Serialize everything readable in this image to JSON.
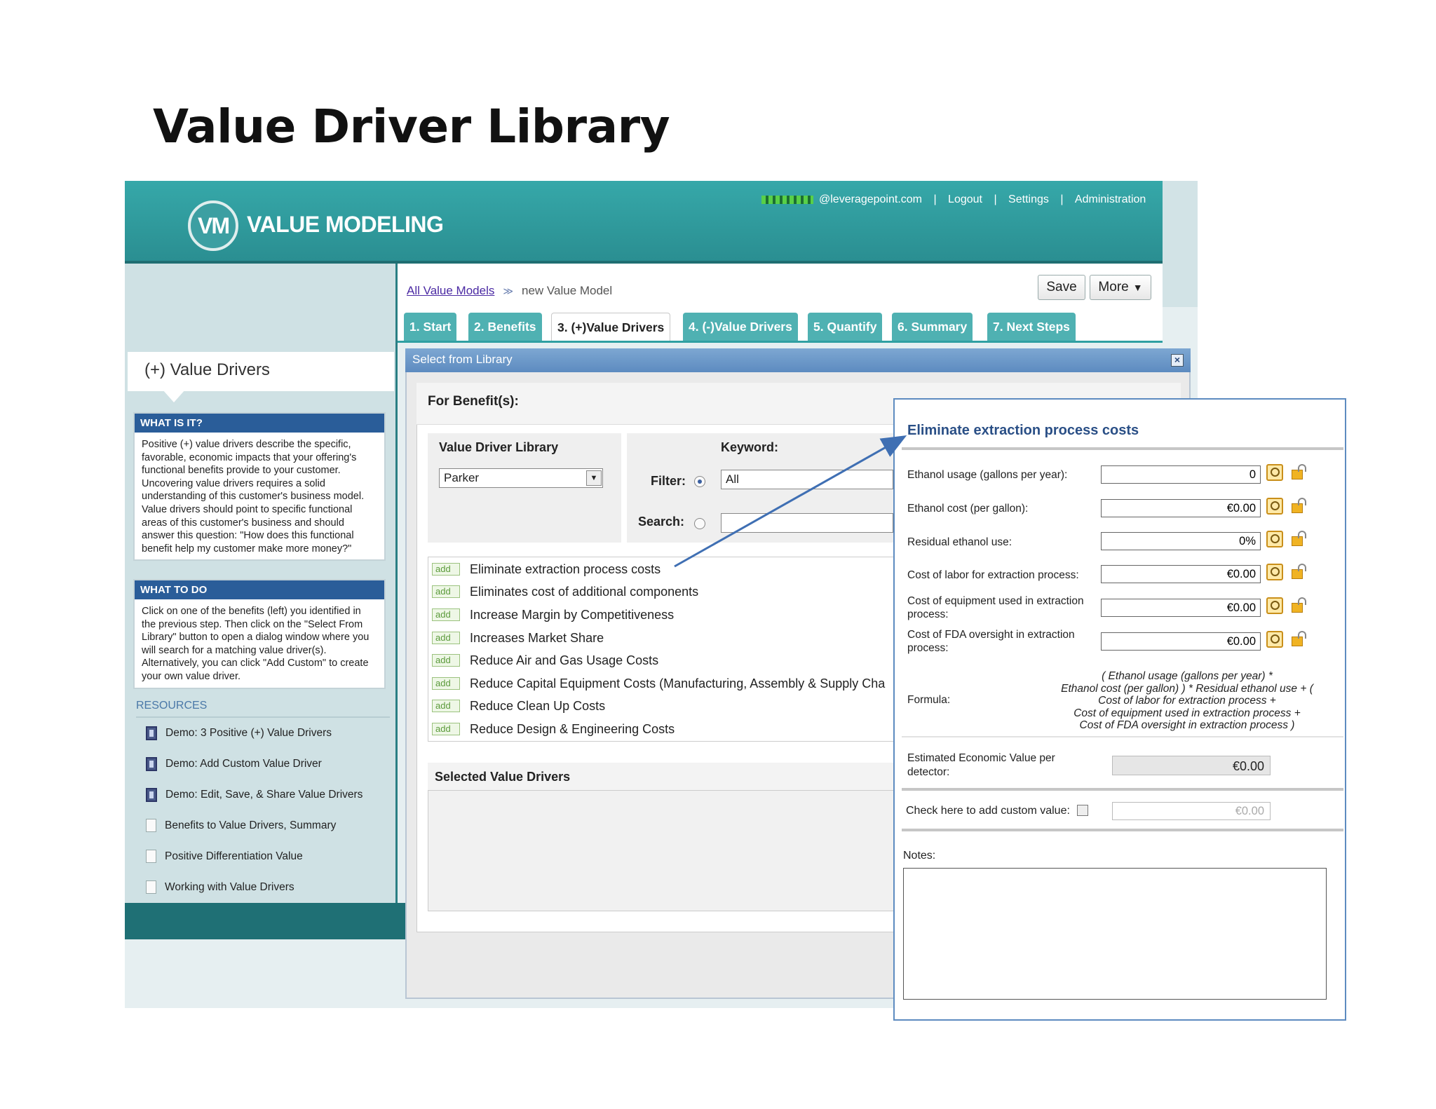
{
  "slide_title": "Value Driver Library",
  "app": {
    "brand_logo": "VM",
    "brand_name": "VALUE MODELING",
    "user_email_suffix": "@leveragepoint.com",
    "nav": {
      "logout": "Logout",
      "settings": "Settings",
      "administration": "Administration"
    }
  },
  "left_panel": {
    "tab_label": "(+) Value Drivers",
    "what_is_it": {
      "heading": "WHAT IS IT?",
      "body": "Positive (+) value drivers describe the specific, favorable, economic impacts that your offering's functional benefits provide to your customer. Uncovering value drivers requires a solid understanding of this customer's business model. Value drivers should point to specific functional areas of this customer's business and should answer this question: \"How does this functional benefit help my customer make more money?\""
    },
    "what_to_do": {
      "heading": "WHAT TO DO",
      "body": "Click on one of the benefits (left) you identified in the previous step. Then click on the \"Select From Library\" button to open a dialog window where you will search for a matching value driver(s). Alternatively, you can click \"Add Custom\" to create your own value driver."
    },
    "resources": {
      "heading": "RESOURCES",
      "items": [
        {
          "label": "Demo: 3 Positive (+) Value Drivers",
          "icon": "film-icon"
        },
        {
          "label": "Demo: Add Custom Value Driver",
          "icon": "film-icon"
        },
        {
          "label": "Demo: Edit, Save, & Share Value Drivers",
          "icon": "film-icon"
        },
        {
          "label": "Benefits to Value Drivers, Summary",
          "icon": "document-icon"
        },
        {
          "label": "Positive Differentiation Value",
          "icon": "document-icon"
        },
        {
          "label": "Working with Value Drivers",
          "icon": "document-icon"
        }
      ]
    }
  },
  "breadcrumb": {
    "root": "All Value Models",
    "separator": "≫",
    "current": "new Value Model"
  },
  "toolbar": {
    "save": "Save",
    "more": "More"
  },
  "tabs": [
    {
      "label": "1. Start",
      "active": false
    },
    {
      "label": "2. Benefits",
      "active": false
    },
    {
      "label": "3. (+)Value Drivers",
      "active": true
    },
    {
      "label": "4. (-)Value Drivers",
      "active": false
    },
    {
      "label": "5. Quantify",
      "active": false
    },
    {
      "label": "6. Summary",
      "active": false
    },
    {
      "label": "7. Next Steps",
      "active": false
    }
  ],
  "dialog": {
    "title": "Select from Library",
    "close": "×",
    "for_benefits": "For Benefit(s):",
    "library_label": "Value Driver Library",
    "library_value": "Parker",
    "keyword_label": "Keyword:",
    "filter_label": "Filter:",
    "filter_value": "All",
    "search_label": "Search:",
    "add_label": "add",
    "results": [
      "Eliminate extraction process costs",
      "Eliminates cost of additional components",
      "Increase Margin by Competitiveness",
      "Increases Market Share",
      "Reduce Air and Gas Usage Costs",
      "Reduce Capital Equipment Costs (Manufacturing, Assembly & Supply Cha",
      "Reduce Clean Up Costs",
      "Reduce Design & Engineering Costs"
    ],
    "selected_heading": "Selected Value Drivers"
  },
  "popup": {
    "title": "Eliminate extraction process costs",
    "fields": [
      {
        "label": "Ethanol usage (gallons per year):",
        "value": "0"
      },
      {
        "label": "Ethanol cost (per gallon):",
        "value": "€0.00"
      },
      {
        "label": "Residual ethanol use:",
        "value": "0%"
      },
      {
        "label": "Cost of labor for extraction process:",
        "value": "€0.00"
      },
      {
        "label": "Cost of equipment used in extraction process:",
        "value": "€0.00"
      },
      {
        "label": "Cost of FDA oversight in extraction process:",
        "value": "€0.00"
      }
    ],
    "formula_label": "Formula:",
    "formula_lines": [
      "( Ethanol usage (gallons per year) *",
      "Ethanol cost (per gallon) ) * Residual ethanol use + (",
      "Cost of labor for extraction process +",
      "Cost of equipment used in extraction process +",
      "Cost of FDA oversight in extraction process )"
    ],
    "estimated_label": "Estimated Economic Value per detector:",
    "estimated_value": "€0.00",
    "custom_label": "Check here to add custom value:",
    "custom_value": "€0.00",
    "notes_label": "Notes:"
  },
  "colors": {
    "header_teal": "#2f9a9c",
    "dialog_blue": "#6a97c8",
    "sidebar_head_blue": "#2a5d99"
  }
}
